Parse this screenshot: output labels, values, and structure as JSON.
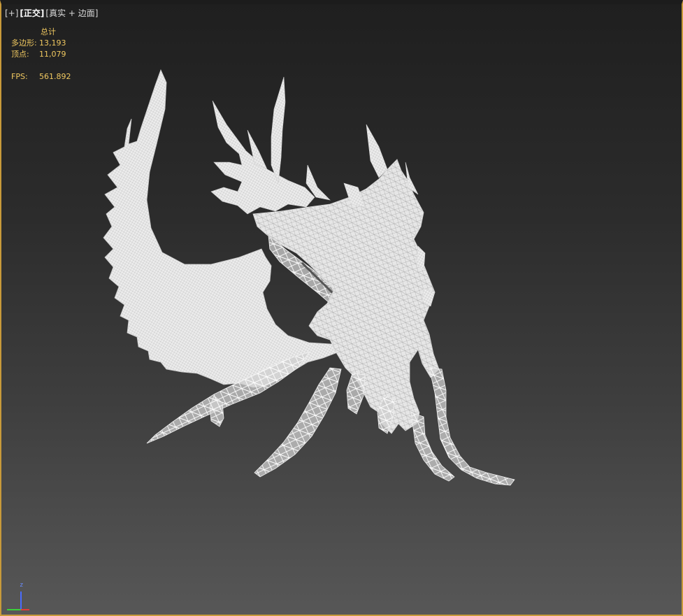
{
  "viewport": {
    "label_parts": [
      "[+]",
      "[正交]",
      "[真实 + 边面]"
    ],
    "active_label_index": 1
  },
  "stats": {
    "header": "总计",
    "polygons_label": "多边形:",
    "polygons_value": "13,193",
    "vertices_label": "顶点:",
    "vertices_value": "11,079",
    "fps_label": "FPS:",
    "fps_value": "561.892"
  },
  "gizmo": {
    "axis_label": "z",
    "x_color": "#e23a3a",
    "y_color": "#3ad13a",
    "z_color": "#4a6cff"
  },
  "colors": {
    "border_accent": "#c89a3a",
    "stats_text": "#f0c860",
    "model_fill": "#e4e4e4",
    "model_wire": "#9a9a9a"
  },
  "model": {
    "icon": "winged-dragon-mesh",
    "render_mode": "wireframe-over-shaded"
  }
}
